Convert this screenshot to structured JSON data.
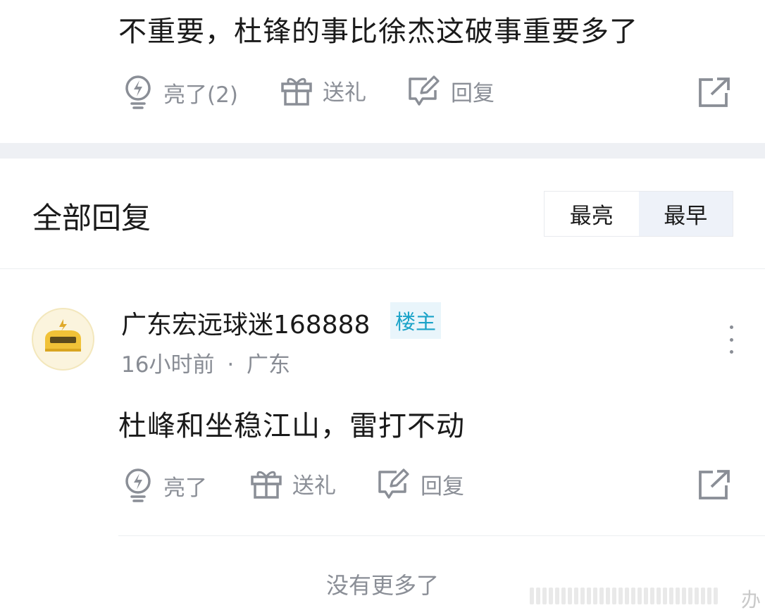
{
  "top_comment": {
    "text": "不重要，杜锋的事比徐杰这破事重要多了",
    "actions": {
      "like_label": "亮了(2)",
      "gift_label": "送礼",
      "reply_label": "回复"
    }
  },
  "replies_section": {
    "title": "全部回复",
    "sort_options": [
      "最亮",
      "最早"
    ],
    "selected_sort": "最早"
  },
  "reply": {
    "username": "广东宏远球迷168888",
    "badge": "楼主",
    "time": "16小时前",
    "separator": "·",
    "location": "广东",
    "text": "杜峰和坐稳江山，雷打不动",
    "actions": {
      "like_label": "亮了",
      "gift_label": "送礼",
      "reply_label": "回复"
    }
  },
  "footer": {
    "no_more": "没有更多了",
    "watermark_char": "办"
  },
  "colors": {
    "text": "#1a1a1a",
    "muted": "#8a8e96",
    "badge_text": "#1aa3c8",
    "badge_bg": "#e9f5fb",
    "section_band": "#eef0f4"
  }
}
